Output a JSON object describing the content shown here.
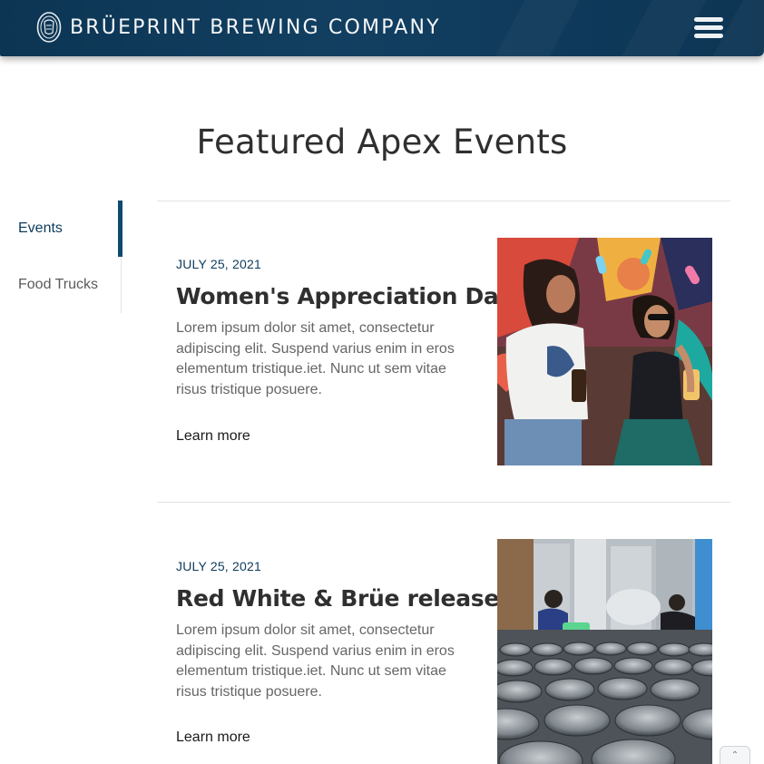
{
  "header": {
    "brand_name": "BRÜEPRINT BREWING COMPANY",
    "logo_icon": "brewery-seal-logo",
    "menu_icon": "hamburger-menu-icon",
    "background_color": "#0e3a5a"
  },
  "page": {
    "title": "Featured Apex Events"
  },
  "sidebar": {
    "items": [
      {
        "label": "Events",
        "active": true
      },
      {
        "label": "Food Trucks",
        "active": false
      }
    ],
    "accent_color": "#0e4a70"
  },
  "events": [
    {
      "date": "JULY 25, 2021",
      "title": "Women's Appreciation Day",
      "description": "Lorem ipsum dolor sit amet, consectetur adipiscing elit. Suspend varius enim in eros elementum tristique.iet. Nunc ut sem vitae risus tristique posuere.",
      "link_label": "Learn more",
      "image_icon": "women-with-beer-photo"
    },
    {
      "date": "JULY 25, 2021",
      "title": "Red White & Brüe release!",
      "description": "Lorem ipsum dolor sit amet, consectetur adipiscing elit. Suspend varius enim in eros elementum tristique.iet. Nunc ut sem vitae risus tristique posuere.",
      "link_label": "Learn more",
      "image_icon": "brewery-canning-line-photo"
    }
  ],
  "scroll_top": {
    "icon": "chevron-up-icon",
    "glyph": "⌃"
  }
}
